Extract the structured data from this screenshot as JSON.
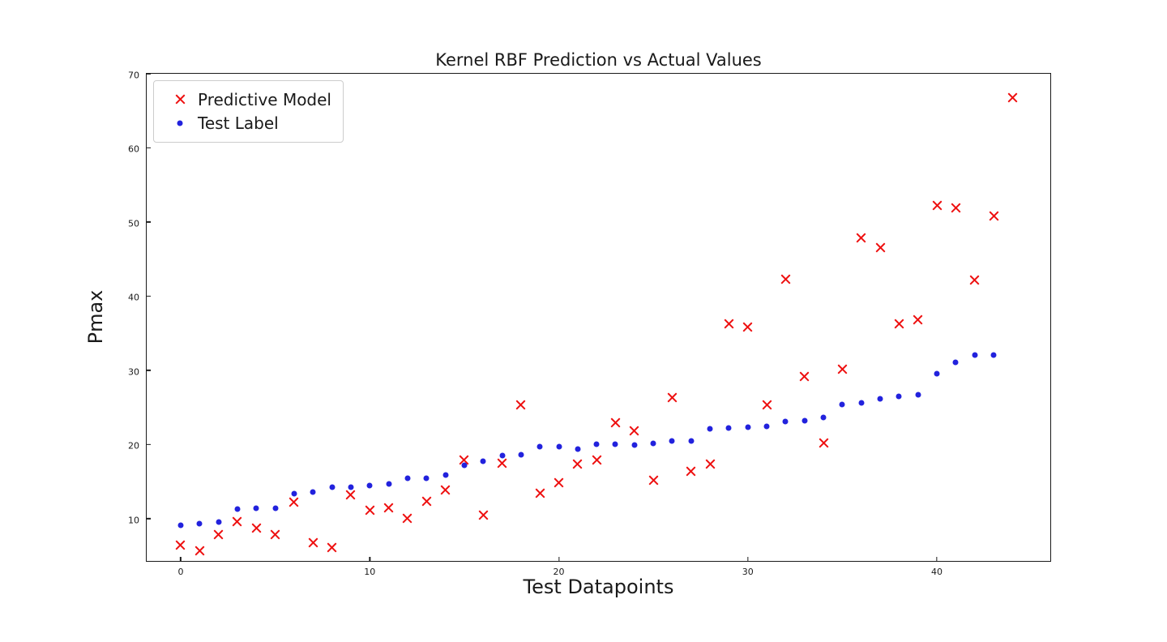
{
  "chart_data": {
    "type": "scatter",
    "title": "Kernel RBF Prediction vs Actual Values",
    "xlabel": "Test Datapoints",
    "ylabel": "Pmax",
    "xlim": [
      -1.8,
      46.0
    ],
    "ylim": [
      4.3,
      70.0
    ],
    "xticks": [
      0,
      10,
      20,
      30,
      40
    ],
    "yticks": [
      10,
      20,
      30,
      40,
      50,
      60,
      70
    ],
    "grid": false,
    "legend_position": "upper left",
    "series": [
      {
        "name": "Predictive Model",
        "marker": "x",
        "color": "#ee1111",
        "points": [
          [
            0,
            6.4
          ],
          [
            1,
            5.7
          ],
          [
            2,
            7.8
          ],
          [
            3,
            9.6
          ],
          [
            4,
            8.7
          ],
          [
            5,
            7.9
          ],
          [
            6,
            12.2
          ],
          [
            7,
            6.8
          ],
          [
            8,
            6.1
          ],
          [
            9,
            13.2
          ],
          [
            10,
            11.1
          ],
          [
            11,
            11.5
          ],
          [
            12,
            10.0
          ],
          [
            13,
            12.3
          ],
          [
            14,
            13.9
          ],
          [
            15,
            17.9
          ],
          [
            16,
            10.5
          ],
          [
            17,
            17.5
          ],
          [
            18,
            25.3
          ],
          [
            19,
            13.4
          ],
          [
            20,
            14.9
          ],
          [
            21,
            17.4
          ],
          [
            22,
            17.9
          ],
          [
            23,
            22.9
          ],
          [
            24,
            21.9
          ],
          [
            25,
            15.2
          ],
          [
            26,
            26.3
          ],
          [
            27,
            16.4
          ],
          [
            28,
            17.4
          ],
          [
            29,
            36.3
          ],
          [
            30,
            35.8
          ],
          [
            31,
            25.3
          ],
          [
            32,
            42.3
          ],
          [
            33,
            29.2
          ],
          [
            34,
            20.2
          ],
          [
            35,
            30.1
          ],
          [
            36,
            47.9
          ],
          [
            37,
            46.5
          ],
          [
            38,
            36.3
          ],
          [
            39,
            36.8
          ],
          [
            40,
            52.2
          ],
          [
            41,
            51.9
          ],
          [
            42,
            42.2
          ],
          [
            43,
            50.8
          ],
          [
            44,
            66.8
          ]
        ]
      },
      {
        "name": "Test Label",
        "marker": "o",
        "color": "#2222dd",
        "points": [
          [
            0,
            9.1
          ],
          [
            1,
            9.3
          ],
          [
            2,
            9.6
          ],
          [
            3,
            11.3
          ],
          [
            4,
            11.4
          ],
          [
            5,
            11.4
          ],
          [
            6,
            13.4
          ],
          [
            7,
            13.6
          ],
          [
            8,
            14.2
          ],
          [
            9,
            14.3
          ],
          [
            10,
            14.5
          ],
          [
            11,
            14.7
          ],
          [
            12,
            15.4
          ],
          [
            13,
            15.5
          ],
          [
            14,
            15.9
          ],
          [
            15,
            17.2
          ],
          [
            16,
            17.7
          ],
          [
            17,
            18.5
          ],
          [
            18,
            18.6
          ],
          [
            19,
            19.7
          ],
          [
            20,
            19.7
          ],
          [
            21,
            19.4
          ],
          [
            22,
            20.0
          ],
          [
            23,
            20.0
          ],
          [
            24,
            19.9
          ],
          [
            25,
            20.2
          ],
          [
            26,
            20.5
          ],
          [
            27,
            20.5
          ],
          [
            28,
            22.1
          ],
          [
            29,
            22.2
          ],
          [
            30,
            22.3
          ],
          [
            31,
            22.4
          ],
          [
            32,
            23.1
          ],
          [
            33,
            23.2
          ],
          [
            34,
            23.6
          ],
          [
            35,
            25.4
          ],
          [
            36,
            25.6
          ],
          [
            37,
            26.2
          ],
          [
            38,
            26.5
          ],
          [
            39,
            26.7
          ],
          [
            40,
            29.6
          ],
          [
            41,
            31.1
          ],
          [
            42,
            32.1
          ],
          [
            43,
            32.1
          ]
        ]
      }
    ]
  },
  "legend": {
    "entries": [
      {
        "label": "Predictive Model",
        "marker": "cross-marker-icon"
      },
      {
        "label": "Test Label",
        "marker": "dot-marker-icon"
      }
    ]
  }
}
